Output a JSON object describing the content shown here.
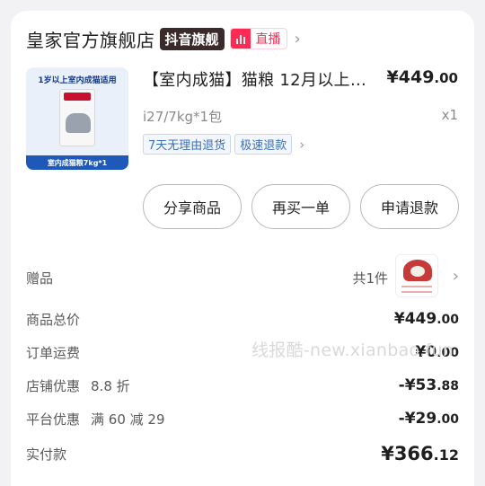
{
  "shop": {
    "name": "皇家官方旗舰店",
    "flagship_badge": "抖音旗舰",
    "live_label": "直播"
  },
  "product": {
    "thumb_top_text": "1岁以上室内成猫适用",
    "thumb_bottom_text": "室内成猫粮7kg*1",
    "title": "【室内成猫】猫粮 12月以上…",
    "price_main": "¥449",
    "price_cents": ".00",
    "spec": "i27/7kg*1包",
    "quantity": "x1",
    "tags": [
      "7天无理由退货",
      "极速退款"
    ]
  },
  "actions": {
    "share": "分享商品",
    "rebuy": "再买一单",
    "refund": "申请退款"
  },
  "gift": {
    "label": "赠品",
    "count": "共1件"
  },
  "fees": {
    "subtotal_label": "商品总价",
    "subtotal_main": "¥449",
    "subtotal_cents": ".00",
    "shipping_label": "订单运费",
    "shipping_main": "¥0",
    "shipping_cents": ".00",
    "store_discount_label": "店铺优惠",
    "store_discount_desc": "8.8 折",
    "store_discount_main": "-¥53",
    "store_discount_cents": ".88",
    "platform_discount_label": "平台优惠",
    "platform_discount_desc": "满 60 减 29",
    "platform_discount_main": "-¥29",
    "platform_discount_cents": ".00",
    "paid_label": "实付款",
    "paid_main": "¥366",
    "paid_cents": ".12"
  },
  "watermark": "线报酷-new.xianbao.fun",
  "icons": {
    "chevron": "chevron-right-icon",
    "live": "live-bars-icon"
  },
  "colors": {
    "accent_red": "#fe2c55",
    "tag_blue": "#3d6fb6",
    "badge_dark": "#3b2a2c"
  }
}
